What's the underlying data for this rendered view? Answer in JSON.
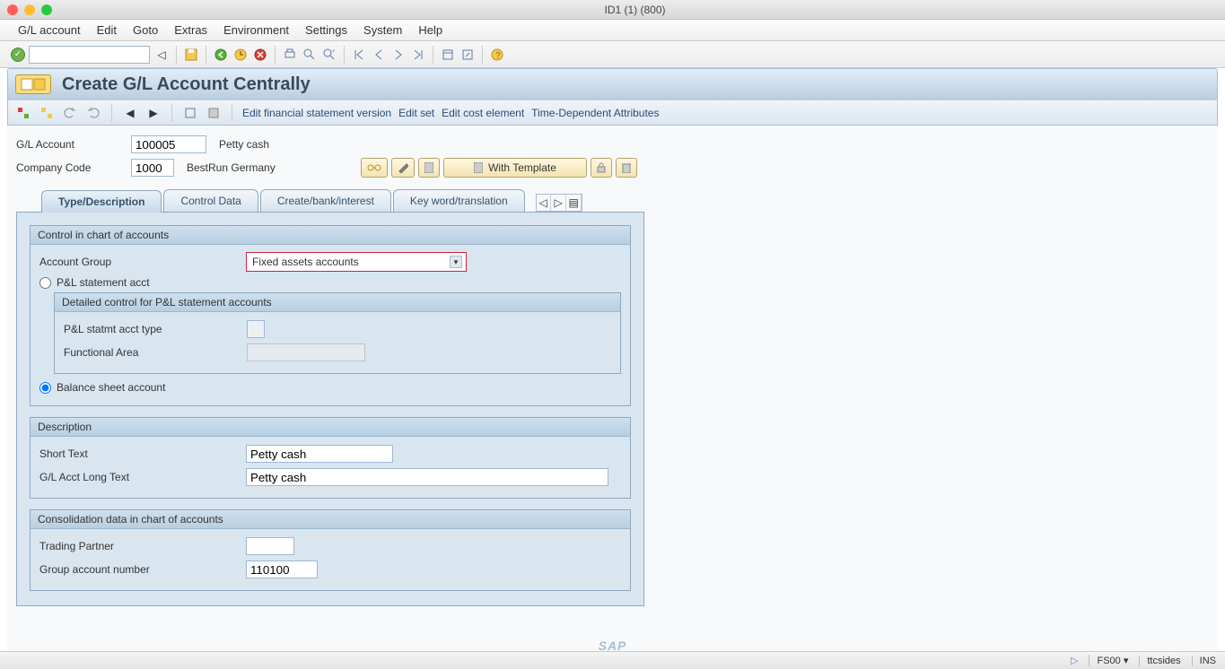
{
  "window": {
    "title": "ID1 (1) (800)"
  },
  "menubar": [
    "G/L account",
    "Edit",
    "Goto",
    "Extras",
    "Environment",
    "Settings",
    "System",
    "Help"
  ],
  "page_title": "Create G/L Account Centrally",
  "sub_toolbar": {
    "links": [
      "Edit financial statement version",
      "Edit set",
      "Edit cost element",
      "Time-Dependent Attributes"
    ]
  },
  "header": {
    "gl_account_label": "G/L Account",
    "gl_account_value": "100005",
    "gl_account_desc": "Petty cash",
    "company_code_label": "Company Code",
    "company_code_value": "1000",
    "company_code_desc": "BestRun Germany",
    "with_template": "With Template"
  },
  "tabs": [
    "Type/Description",
    "Control Data",
    "Create/bank/interest",
    "Key word/translation"
  ],
  "group1": {
    "title": "Control in chart of accounts",
    "account_group_label": "Account Group",
    "account_group_value": "Fixed assets accounts",
    "pl_radio": "P&L statement acct",
    "sub_title": "Detailed control for P&L statement accounts",
    "pl_type_label": "P&L statmt acct type",
    "func_area_label": "Functional Area",
    "bs_radio": "Balance sheet account"
  },
  "group2": {
    "title": "Description",
    "short_label": "Short Text",
    "short_value": "Petty cash",
    "long_label": "G/L Acct Long Text",
    "long_value": "Petty cash"
  },
  "group3": {
    "title": "Consolidation data in chart of accounts",
    "trading_label": "Trading Partner",
    "group_acct_label": "Group account number",
    "group_acct_value": "110100"
  },
  "status": {
    "tcode": "FS00",
    "user": "ttcsides",
    "mode": "INS"
  }
}
